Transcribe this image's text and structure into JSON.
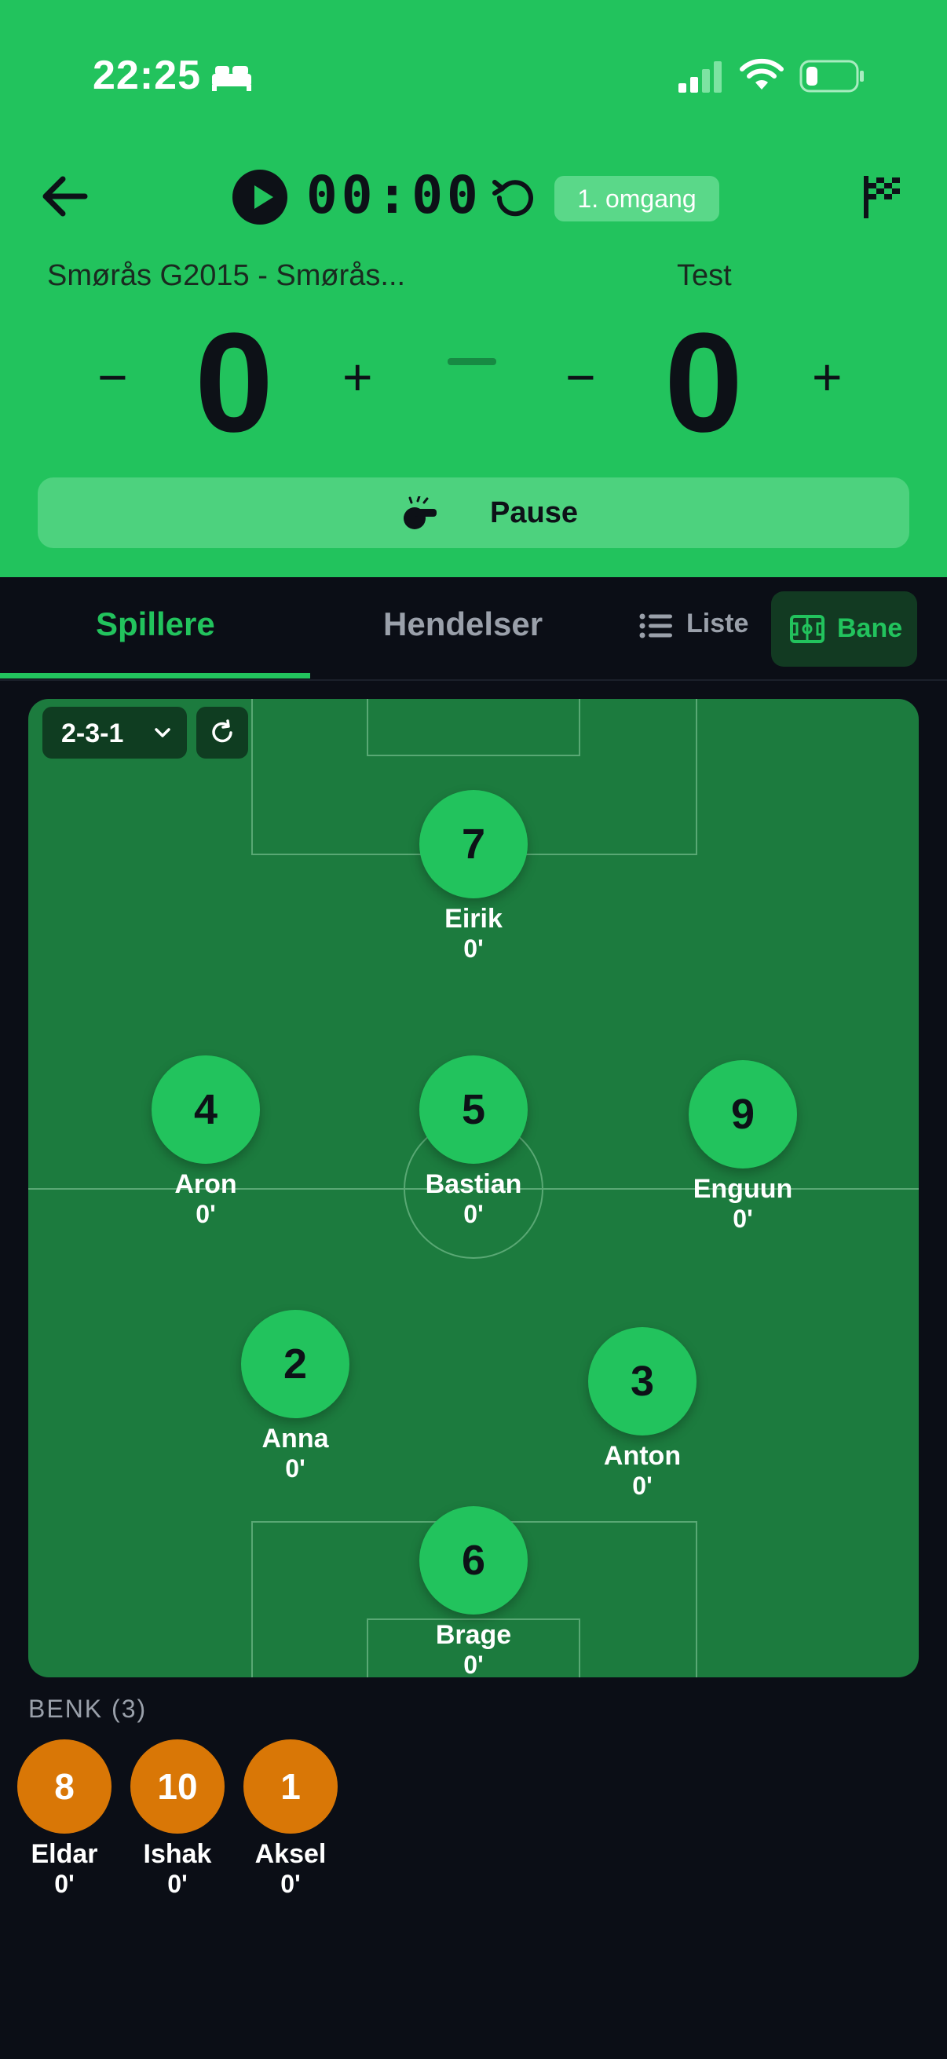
{
  "status_bar": {
    "time": "22:25"
  },
  "match": {
    "timer": "00:00",
    "period": "1. omgang",
    "home_team": "Smørås G2015 - Smørås...",
    "away_team": "Test",
    "home_score": "0",
    "away_score": "0",
    "minus_label": "−",
    "plus_label": "+",
    "pause_label": "Pause"
  },
  "tabs": {
    "players": "Spillere",
    "events": "Hendelser"
  },
  "view_toggle": {
    "list": "Liste",
    "pitch": "Bane"
  },
  "formation": {
    "selected": "2-3-1"
  },
  "players": [
    {
      "number": "7",
      "name": "Eirik",
      "minutes": "0'"
    },
    {
      "number": "4",
      "name": "Aron",
      "minutes": "0'"
    },
    {
      "number": "5",
      "name": "Bastian",
      "minutes": "0'"
    },
    {
      "number": "9",
      "name": "Enguun",
      "minutes": "0'"
    },
    {
      "number": "2",
      "name": "Anna",
      "minutes": "0'"
    },
    {
      "number": "3",
      "name": "Anton",
      "minutes": "0'"
    },
    {
      "number": "6",
      "name": "Brage",
      "minutes": "0'"
    }
  ],
  "bench": {
    "title": "BENK (3)",
    "players": [
      {
        "number": "8",
        "name": "Eldar",
        "minutes": "0'"
      },
      {
        "number": "10",
        "name": "Ishak",
        "minutes": "0'"
      },
      {
        "number": "1",
        "name": "Aksel",
        "minutes": "0'"
      }
    ]
  },
  "colors": {
    "accent": "#22c35d",
    "bench": "#d97706",
    "pitch": "#1c7b3e",
    "background": "#0b0e16"
  }
}
